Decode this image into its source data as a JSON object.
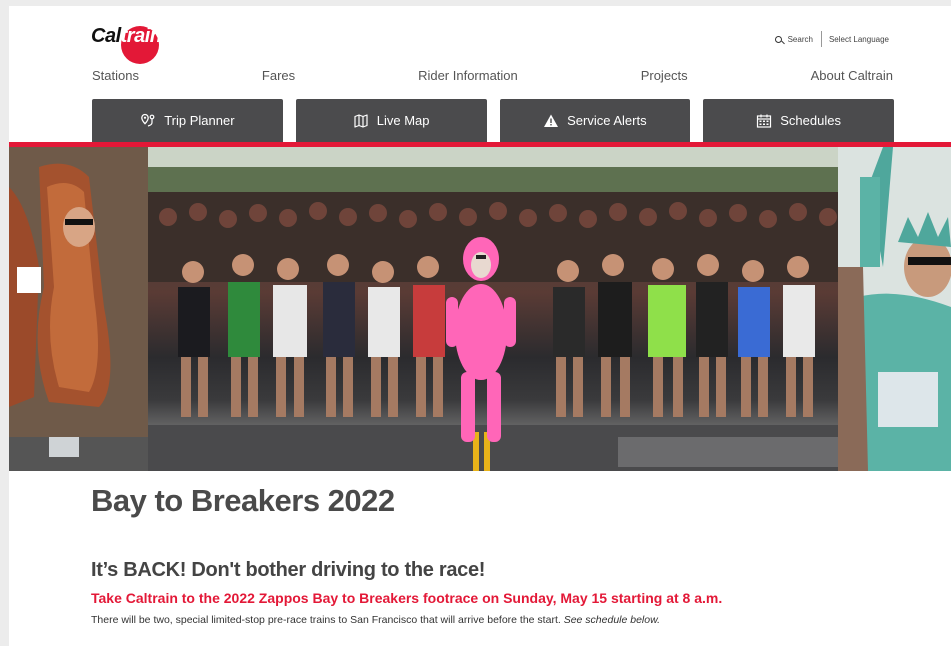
{
  "logo": {
    "cal": "Cal",
    "train": "train"
  },
  "utility": {
    "search_label": "Search",
    "language_label": "Select Language"
  },
  "nav": {
    "items": [
      "Stations",
      "Fares",
      "Rider Information",
      "Projects",
      "About Caltrain"
    ]
  },
  "quick_links": [
    {
      "label": "Trip Planner",
      "icon": "trip-planner-icon"
    },
    {
      "label": "Live Map",
      "icon": "map-icon"
    },
    {
      "label": "Service Alerts",
      "icon": "alert-icon"
    },
    {
      "label": "Schedules",
      "icon": "calendar-icon"
    }
  ],
  "colors": {
    "brand_red": "#e31837",
    "button_gray": "#4b4b4d"
  },
  "article": {
    "title": "Bay to Breakers 2022",
    "subtitle": "It’s BACK! Don't bother driving to the race!",
    "highlight": "Take Caltrain to the 2022 Zappos Bay to Breakers  footrace on Sunday, May 15 starting at 8 a.m.",
    "body": "There will be two, special limited-stop pre-race trains to San Francisco that will arrive before the start.",
    "body_italic": "See schedule below."
  }
}
